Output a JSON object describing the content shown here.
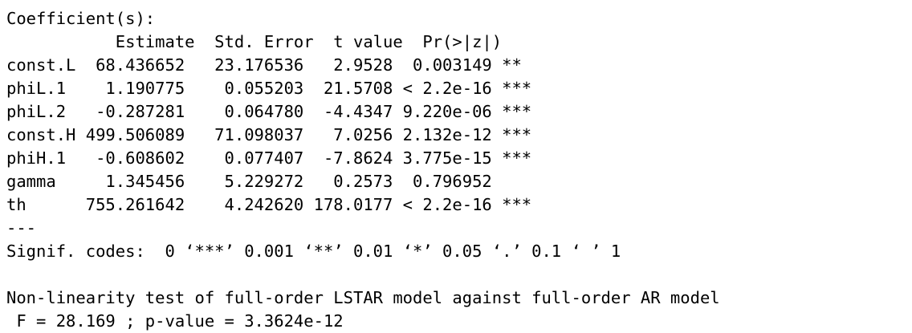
{
  "header": "Coefficient(s):",
  "columns_line": "           Estimate  Std. Error  t value  Pr(>|z|)    ",
  "rows": [
    "const.L  68.436652   23.176536   2.9528  0.003149 ** ",
    "phiL.1    1.190775    0.055203  21.5708 < 2.2e-16 ***",
    "phiL.2   -0.287281    0.064780  -4.4347 9.220e-06 ***",
    "const.H 499.506089   71.098037   7.0256 2.132e-12 ***",
    "phiH.1   -0.608602    0.077407  -7.8624 3.775e-15 ***",
    "gamma     1.345456    5.229272   0.2573  0.796952    ",
    "th      755.261642    4.242620 178.0177 < 2.2e-16 ***"
  ],
  "separator": "---",
  "signif_codes": "Signif. codes:  0 ‘***’ 0.001 ‘**’ 0.01 ‘*’ 0.05 ‘.’ 0.1 ‘ ’ 1",
  "test_title": "Non-linearity test of full-order LSTAR model against full-order AR model",
  "test_result": " F = 28.169 ; p-value = 3.3624e-12"
}
